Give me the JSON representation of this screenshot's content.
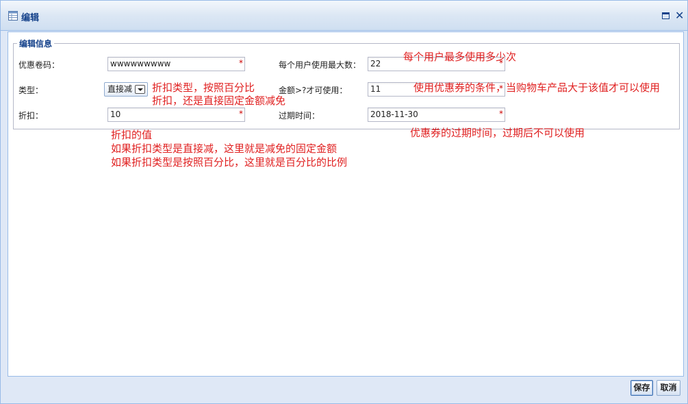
{
  "window": {
    "title": "编辑"
  },
  "form": {
    "legend": "编辑信息",
    "fields": {
      "code": {
        "label": "优惠卷码：",
        "value": "wwwwwwwww"
      },
      "max_use": {
        "label": "每个用户使用最大数：",
        "value": "22"
      },
      "type": {
        "label": "类型：",
        "value": "直接减"
      },
      "threshold": {
        "label": "金额>?才可使用：",
        "value": "11"
      },
      "discount": {
        "label": "折扣：",
        "value": "10"
      },
      "expire": {
        "label": "过期时间：",
        "value": "2018-11-30"
      }
    },
    "required_mark": "*"
  },
  "annotations": {
    "max_use_note": "每个用户最多使用多少次",
    "type_note_line1": "折扣类型，按照百分比",
    "type_note_line2": "折扣，还是直接固定金额减免",
    "threshold_note": "使用优惠券的条件，当购物车产品大于该值才可以使用",
    "discount_note_line1": "折扣的值",
    "discount_note_line2": "如果折扣类型是直接减，这里就是减免的固定金额",
    "discount_note_line3": "如果折扣类型是按照百分比，这里就是百分比的比例",
    "expire_note": "优惠券的过期时间，过期后不可以使用"
  },
  "buttons": {
    "save": "保存",
    "cancel": "取消"
  },
  "colors": {
    "annotation": "#e02020",
    "required": "#cc0000",
    "title": "#15428b"
  }
}
